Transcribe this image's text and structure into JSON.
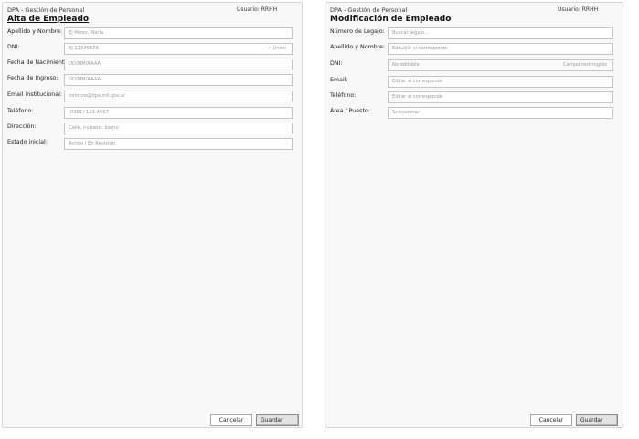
{
  "alta": {
    "app_name": "DPA - Gestión de Personal",
    "user": "Usuario: RRHH",
    "title": "Alta de Empleado",
    "fields": [
      {
        "label": "Apellido y Nombre:",
        "placeholder": "Ej Pérez, María"
      },
      {
        "label": "DNI:",
        "placeholder": "Ej 12345678",
        "suffix": "✓ Único"
      },
      {
        "label": "Fecha de Nacimiento:",
        "placeholder": "DD/MM/AAAA"
      },
      {
        "label": "Fecha de Ingreso:",
        "placeholder": "DD/MM/AAAA"
      },
      {
        "label": "Email institucional:",
        "placeholder": "nombre@dpa.mil.gov.ar"
      },
      {
        "label": "Teléfono:",
        "placeholder": "(0381) 123-4567"
      },
      {
        "label": "Dirección:",
        "placeholder": "Calle, número, barrio"
      },
      {
        "label": "Estado inicial:",
        "placeholder": "Activo / En Revisión"
      }
    ],
    "cancel": "Cancelar",
    "save": "Guardar"
  },
  "mod": {
    "app_name": "DPA - Gestión de Personal",
    "user": "Usuario: RRHH",
    "title": "Modificación de Empleado",
    "fields": [
      {
        "label": "Número de Legajo:",
        "placeholder": "Buscar legajo..."
      },
      {
        "label": "Apellido y Nombre:",
        "placeholder": "Editable si corresponde"
      },
      {
        "label": "DNI:",
        "placeholder": "No editable",
        "suffix": "Campo restringido"
      },
      {
        "label": "Email:",
        "placeholder": "Editar si corresponde"
      },
      {
        "label": "Teléfono:",
        "placeholder": "Editar si corresponde"
      },
      {
        "label": "Área / Puesto:",
        "placeholder": "Seleccionar"
      }
    ],
    "cancel": "Cancelar",
    "save": "Guardar"
  }
}
